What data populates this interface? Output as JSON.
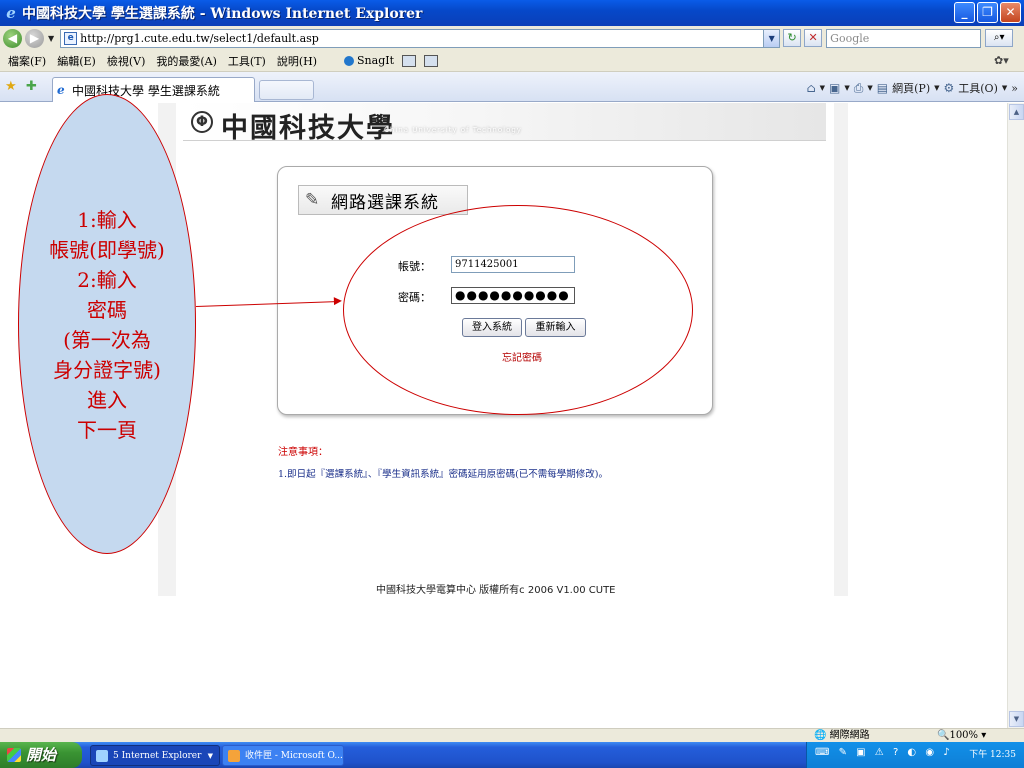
{
  "window": {
    "title": "中國科技大學 學生選課系統 - Windows Internet Explorer",
    "minimize": "_",
    "maximize": "❐",
    "close": "✕"
  },
  "address": {
    "back_icon": "back-arrow-icon",
    "forward_icon": "forward-arrow-icon",
    "url": "http://prg1.cute.edu.tw/select1/default.asp",
    "search_placeholder": "Google"
  },
  "menu": {
    "items": [
      "檔案(F)",
      "編輯(E)",
      "檢視(V)",
      "我的最愛(A)",
      "工具(T)",
      "說明(H)"
    ],
    "snagit_label": "SnagIt"
  },
  "tabs": {
    "active_label": "中國科技大學 學生選課系統",
    "command_page": "網頁(P)",
    "command_tools": "工具(O)"
  },
  "page": {
    "school_name": "中國科技大學",
    "school_name_en": "China University of Technology",
    "system_title": "網路選課系統",
    "account_label": "帳號：",
    "account_value": "9711425001",
    "password_label": "密碼：",
    "password_value": "●●●●●●●●●●",
    "login_button": "登入系統",
    "reset_button": "重新輸入",
    "forgot_link": "忘記密碼",
    "notice_title": "注意事項：",
    "notice_text": "1.即日起『選課系統』、『學生資訊系統』密碼延用原密碼(已不需每學期修改)。",
    "footer": "中國科技大學電算中心 版權所有c 2006 V1.00 CUTE"
  },
  "annotation": {
    "lines": [
      "1:輸入",
      "帳號(即學號)",
      "2:輸入",
      "密碼",
      "(第一次為",
      "身分證字號)",
      "進入",
      "下一頁"
    ],
    "color": "#cc0000"
  },
  "status": {
    "zone": "網際網路",
    "zoom": "100%"
  },
  "taskbar": {
    "start": "開始",
    "item_ie": "5 Internet Explorer",
    "item_outlook": "收件匣 - Microsoft O...",
    "clock": "下午 12:35"
  }
}
